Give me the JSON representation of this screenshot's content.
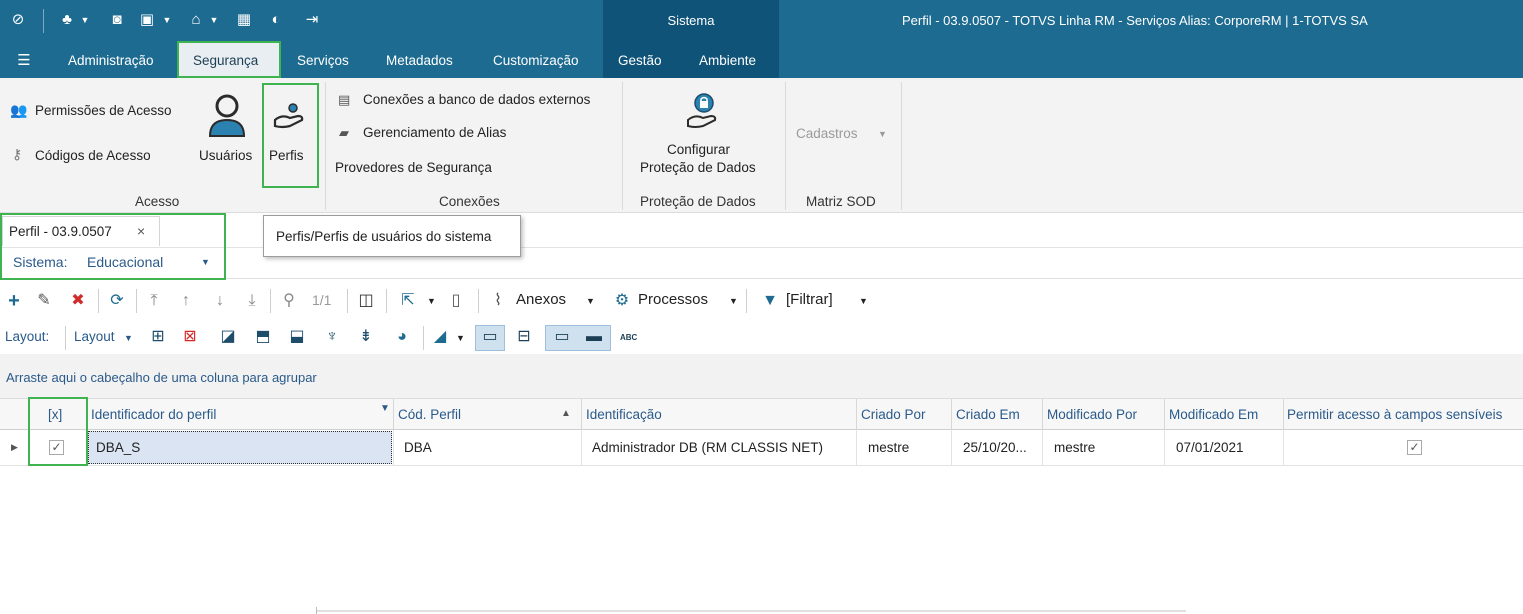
{
  "titlebar": {
    "title": "Perfil - 03.9.0507 - TOTVS Linha RM - Serviços  Alias: CorporeRM | 1-TOTVS SA",
    "context_tab": "Sistema"
  },
  "menu": {
    "items": [
      "Administração",
      "Segurança",
      "Serviços",
      "Metadados",
      "Customização",
      "Gestão",
      "Ambiente"
    ]
  },
  "ribbon": {
    "acesso": {
      "permissoes": "Permissões de Acesso",
      "codigos": "Códigos de Acesso",
      "usuarios": "Usuários",
      "perfis": "Perfis",
      "group": "Acesso"
    },
    "conexoes": {
      "bd_externos": "Conexões a banco de dados externos",
      "alias": "Gerenciamento de Alias",
      "provedores": "Provedores de Segurança",
      "group": "Conexões"
    },
    "protecao": {
      "line1": "Configurar",
      "line2": "Proteção de Dados",
      "group": "Proteção de Dados"
    },
    "matriz": {
      "cadastros": "Cadastros",
      "group": "Matriz SOD"
    }
  },
  "doc_tab": {
    "label": "Perfil - 03.9.0507",
    "close": "×"
  },
  "tooltip": "Perfis/Perfis de usuários do sistema",
  "sistema_filter": {
    "label": "Sistema:",
    "value": "Educacional"
  },
  "toolbar": {
    "paging": "1/1",
    "anexos": "Anexos",
    "processos": "Processos",
    "filtrar": "[Filtrar]"
  },
  "layout_bar": {
    "label": "Layout:",
    "dropdown": "Layout",
    "abc": "ABC"
  },
  "group_hint": "Arraste aqui o cabeçalho de uma coluna para agrupar",
  "grid": {
    "columns": [
      "[x]",
      "Identificador do perfil",
      "Cód. Perfil",
      "Identificação",
      "Criado Por",
      "Criado Em",
      "Modificado Por",
      "Modificado Em",
      "Permitir acesso à campos sensíveis"
    ],
    "rows": [
      {
        "checked": "✓",
        "identificador": "DBA_S",
        "cod": "DBA",
        "identificacao": "Administrador DB (RM CLASSIS NET)",
        "criado_por": "mestre",
        "criado_em": "25/10/20...",
        "modificado_por": "mestre",
        "modificado_em": "07/01/2021",
        "sensiveis": "✓"
      }
    ]
  },
  "colors": {
    "titlebar": "#1d6b91",
    "context_block": "#0f5378",
    "highlight": "#3fb34f",
    "accent_red": "#d12b2b",
    "accent_blue": "#1d6b91"
  }
}
